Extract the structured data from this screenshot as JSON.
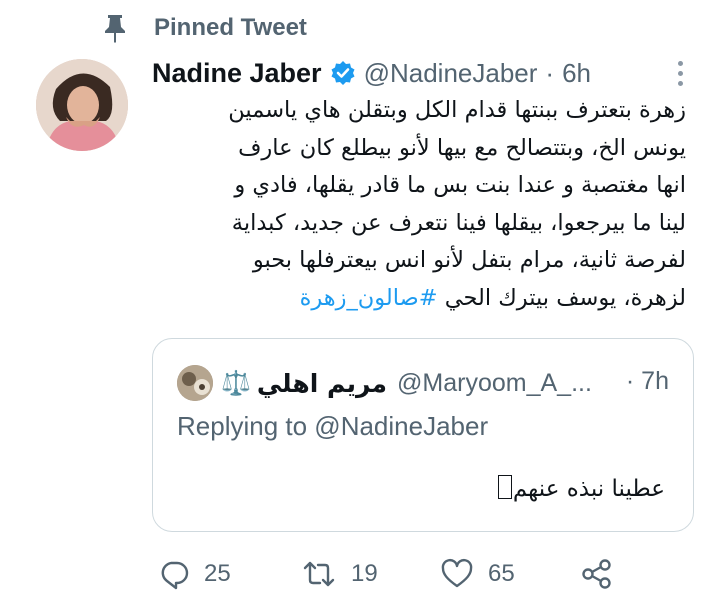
{
  "pinned": {
    "label": "Pinned Tweet",
    "icon": "pin-icon"
  },
  "tweet": {
    "author_name": "Nadine Jaber",
    "handle": "@NadineJaber",
    "separator": "·",
    "time": "6h",
    "lines": [
      "زهرة بتعترف ببنتها قدام  الكل وبتقلن هاي ياسمين",
      "يونس الخ، وبتتصالح مع بيها لأنو بيطلع كان عارف",
      "انها مغتصبة و عندا بنت بس ما قادر يقلها، فادي و",
      "لينا ما بيرجعوا، بيقلها فينا نتعرف عن جديد، كبداية",
      "لفرصة ثانية، مرام بتفل لأنو انس بيعترفلها بحبو",
      "لزهرة، يوسف بيترك الحي"
    ],
    "hashtag": "#صالون_زهرة"
  },
  "quote": {
    "name": "مريم اهلي",
    "scale_emoji": "⚖️",
    "handle": "@Maryoom_A_...",
    "time": "· 7h",
    "replying": "Replying to @NadineJaber",
    "text": "عطينا نبذه عنهم"
  },
  "actions": {
    "reply_count": "25",
    "retweet_count": "19",
    "like_count": "65"
  },
  "colors": {
    "accent": "#1d9bf0",
    "muted": "#536471",
    "text": "#0f1419",
    "border": "#cfd9de"
  }
}
